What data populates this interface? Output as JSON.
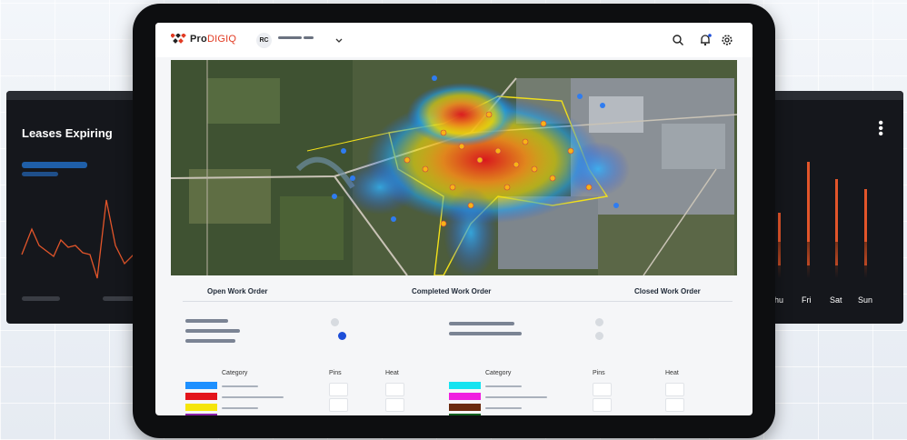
{
  "left_card": {
    "title": "Leases Expiring"
  },
  "right_card": {
    "days": [
      "hu",
      "Fri",
      "Sat",
      "Sun"
    ],
    "menu_icon": "kebab-icon"
  },
  "app": {
    "logo_pro": "Pro",
    "logo_digiq": "DIGIQ",
    "user_initials": "RC",
    "icons": [
      "search-icon",
      "bell-icon",
      "gear-icon"
    ],
    "colors": {
      "brand_red": "#e23b23",
      "toggle_on": "#1d4ed8"
    }
  },
  "tabs": {
    "open": "Open Work Order",
    "completed": "Completed Work Order",
    "closed": "Closed Work Order"
  },
  "legend_left": {
    "category": "Category",
    "pins": "Pins",
    "heat": "Heat",
    "swatches": [
      "#1e90ff",
      "#e3141b",
      "#f5e50b",
      "#8b1fa8"
    ]
  },
  "legend_right": {
    "category": "Category",
    "pins": "Pins",
    "heat": "Heat",
    "swatches": [
      "#16e3f0",
      "#f01ee0",
      "#6b2a0e",
      "#12601f"
    ]
  }
}
